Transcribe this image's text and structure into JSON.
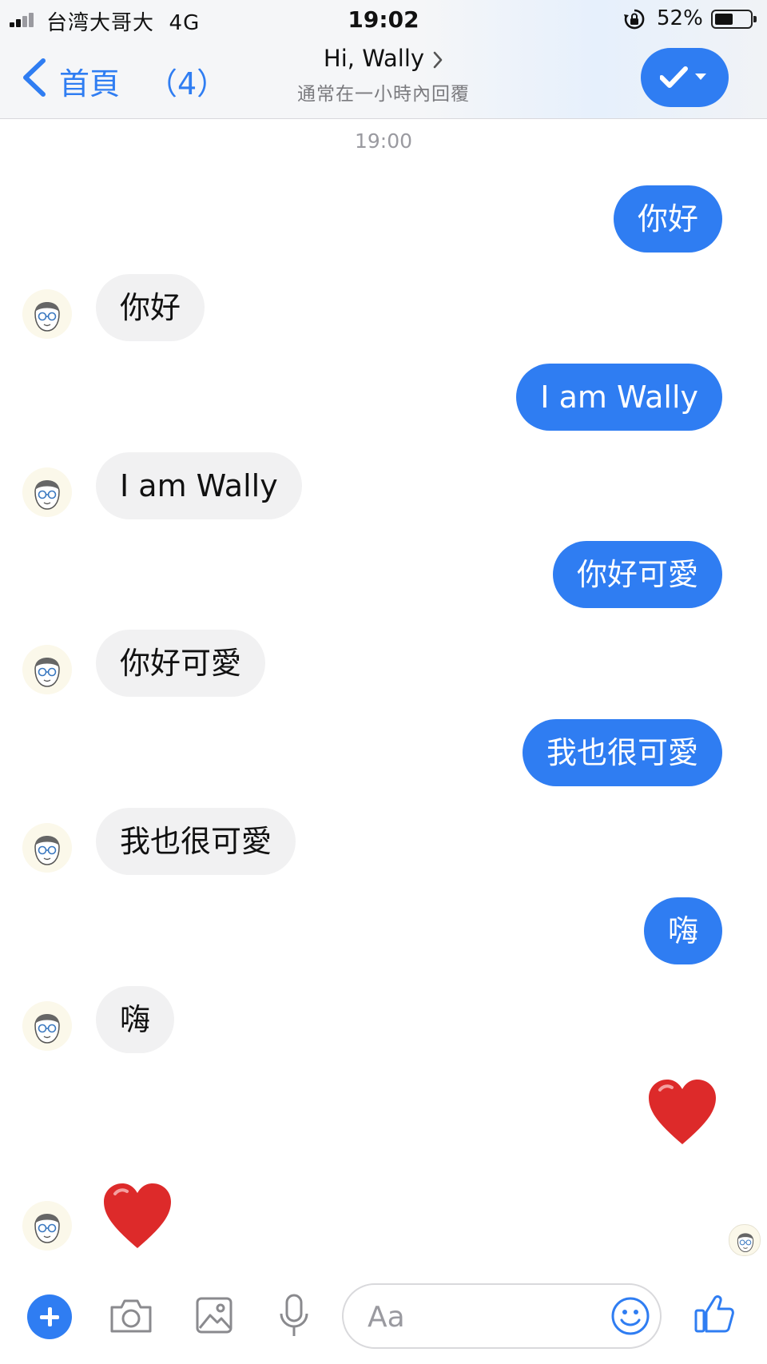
{
  "status_bar": {
    "carrier": "台湾大哥大",
    "network": "4G",
    "time": "19:02",
    "battery_percent": "52%",
    "battery_level": 0.52
  },
  "header": {
    "back_label": "首頁",
    "unread_count": "（4）",
    "title": "Hi, Wally",
    "subtitle": "通常在一小時內回覆",
    "accent_color": "#2f7df2"
  },
  "conversation": {
    "timestamp": "19:00",
    "messages": [
      {
        "direction": "out",
        "text": "你好"
      },
      {
        "direction": "in",
        "text": "你好"
      },
      {
        "direction": "out",
        "text": "I am Wally"
      },
      {
        "direction": "in",
        "text": "I am Wally"
      },
      {
        "direction": "out",
        "text": "你好可愛"
      },
      {
        "direction": "in",
        "text": "你好可愛"
      },
      {
        "direction": "out",
        "text": "我也很可愛"
      },
      {
        "direction": "in",
        "text": "我也很可愛"
      },
      {
        "direction": "out",
        "text": "嗨"
      },
      {
        "direction": "in",
        "text": "嗨"
      },
      {
        "direction": "out",
        "emoji": "heart"
      },
      {
        "direction": "in",
        "emoji": "heart"
      }
    ]
  },
  "composer": {
    "placeholder": "Aa",
    "icons": [
      "plus-icon",
      "camera-icon",
      "image-icon",
      "microphone-icon",
      "emoji-icon",
      "thumbs-up-icon"
    ]
  }
}
